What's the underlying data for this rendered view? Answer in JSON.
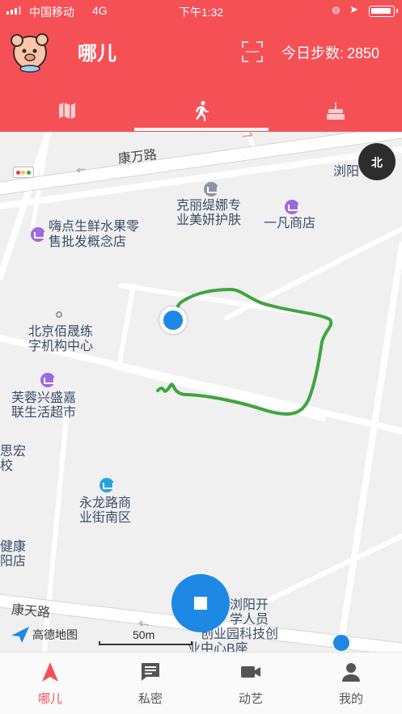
{
  "status_bar": {
    "carrier": "中国移动",
    "network": "4G",
    "time": "下午1:32"
  },
  "header": {
    "title": "哪儿",
    "steps_label": "今日步数:",
    "steps_value": "2850"
  },
  "top_tabs": [
    {
      "icon": "map-icon",
      "active": false
    },
    {
      "icon": "walking-icon",
      "active": true
    },
    {
      "icon": "cake-icon",
      "active": false
    }
  ],
  "map": {
    "compass": "北",
    "labels": {
      "kangwan_road": "康万路",
      "liuyang": "浏阳",
      "kelitina_1": "克丽缇娜专",
      "kelitina_2": "业美妍护肤",
      "yifan": "一凡商店",
      "haidian_1": "嗨点生鲜水果零",
      "haidian_2": "售批发概念店",
      "beijing_1": "北京佰晟练",
      "beijing_2": "字机构中心",
      "furong_1": "芙蓉兴盛嘉",
      "furong_2": "联生活超市",
      "sihong_1": "思宏",
      "sihong_2": "校",
      "yonglong_1": "永龙路商",
      "yonglong_2": "业街南区",
      "jiankang_1": "健康",
      "jiankang_2": "阳店",
      "kangtian_road": "康天路",
      "liuyang_kai_1": "浏阳开",
      "liuyang_kai_2": "学人员",
      "liuyang_kai_3": "创业园科技创",
      "liuyang_kai_4": "业中心B座"
    },
    "logo_text": "高德地图",
    "scale": "50m",
    "track_color": "#3fa53f",
    "accent_blue": "#1e88e5"
  },
  "bottom_nav": [
    {
      "label": "哪儿",
      "icon": "location-arrow-icon",
      "active": true
    },
    {
      "label": "私密",
      "icon": "message-icon",
      "active": false
    },
    {
      "label": "动艺",
      "icon": "video-camera-icon",
      "active": false
    },
    {
      "label": "我的",
      "icon": "person-icon",
      "active": false
    }
  ],
  "colors": {
    "brand": "#f65057",
    "active_nav": "#f65057"
  }
}
